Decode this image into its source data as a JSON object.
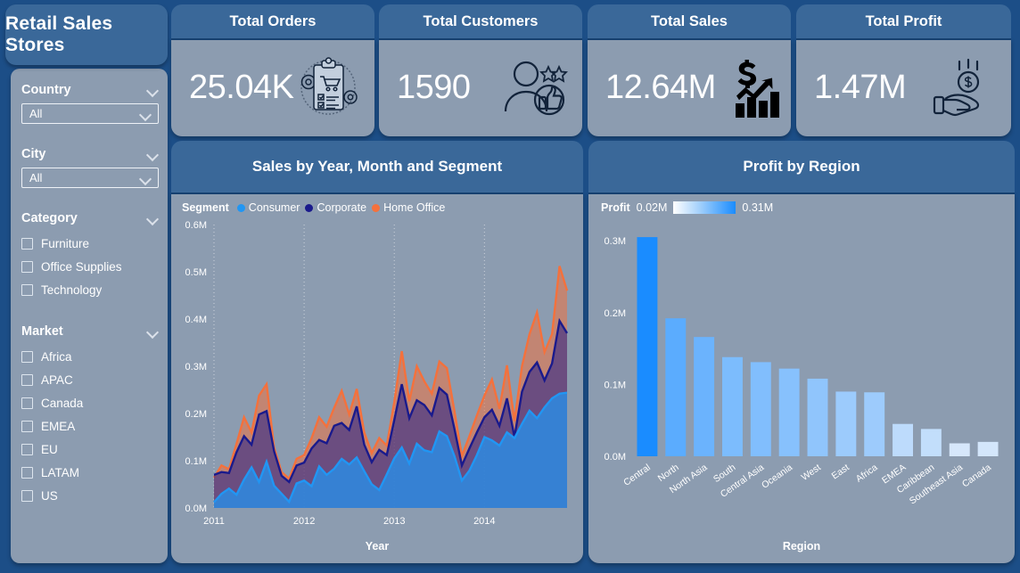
{
  "app": {
    "title": "Retail Sales Stores"
  },
  "sidebar": {
    "filters": [
      {
        "label": "Country",
        "type": "dropdown",
        "value": "All"
      },
      {
        "label": "City",
        "type": "dropdown",
        "value": "All"
      },
      {
        "label": "Category",
        "type": "checkbox",
        "options": [
          "Furniture",
          "Office Supplies",
          "Technology"
        ]
      },
      {
        "label": "Market",
        "type": "checkbox",
        "options": [
          "Africa",
          "APAC",
          "Canada",
          "EMEA",
          "EU",
          "LATAM",
          "US"
        ]
      }
    ]
  },
  "kpis": [
    {
      "title": "Total Orders",
      "value": "25.04K",
      "icon": "clipboard-cart-icon"
    },
    {
      "title": "Total Customers",
      "value": "1590",
      "icon": "customer-thumbsup-icon"
    },
    {
      "title": "Total Sales",
      "value": "12.64M",
      "icon": "dollar-bar-chart-icon"
    },
    {
      "title": "Total Profit",
      "value": "1.47M",
      "icon": "hand-coin-icon"
    }
  ],
  "colors": {
    "page_background": "#1c4e87",
    "panel_header": "#3a6899",
    "panel_body": "#8c9cb0",
    "consumer": "#2196f3",
    "corporate": "#1a1a8c",
    "home_office": "#f4713c",
    "bar_high": "#1a8cff",
    "bar_low": "#d6e7fb"
  },
  "chart_data": [
    {
      "type": "area",
      "title": "Sales by Year, Month and Segment",
      "legend_title": "Segment",
      "legend_position": "top-left",
      "xlabel": "Year",
      "ylabel": "",
      "ylim": [
        0,
        0.6
      ],
      "ytick_labels": [
        "0.0M",
        "0.1M",
        "0.2M",
        "0.3M",
        "0.4M",
        "0.5M",
        "0.6M"
      ],
      "xtick_labels": [
        "2011",
        "2012",
        "2013",
        "2014"
      ],
      "grid": true,
      "stacked": false,
      "series": [
        {
          "name": "Consumer",
          "color": "#2196f3",
          "values": [
            0.012,
            0.03,
            0.041,
            0.028,
            0.06,
            0.086,
            0.055,
            0.098,
            0.047,
            0.03,
            0.013,
            0.052,
            0.058,
            0.046,
            0.088,
            0.07,
            0.083,
            0.104,
            0.092,
            0.107,
            0.078,
            0.05,
            0.038,
            0.071,
            0.105,
            0.128,
            0.094,
            0.136,
            0.122,
            0.118,
            0.162,
            0.152,
            0.11,
            0.058,
            0.079,
            0.112,
            0.15,
            0.143,
            0.132,
            0.16,
            0.148,
            0.178,
            0.206,
            0.19,
            0.213,
            0.232,
            0.242,
            0.244
          ]
        },
        {
          "name": "Corporate",
          "color": "#1a1a8c",
          "values": [
            0.07,
            0.076,
            0.074,
            0.118,
            0.152,
            0.134,
            0.198,
            0.205,
            0.12,
            0.068,
            0.055,
            0.09,
            0.096,
            0.126,
            0.144,
            0.137,
            0.174,
            0.18,
            0.165,
            0.215,
            0.134,
            0.097,
            0.123,
            0.112,
            0.186,
            0.262,
            0.19,
            0.228,
            0.218,
            0.196,
            0.254,
            0.24,
            0.168,
            0.09,
            0.126,
            0.16,
            0.192,
            0.208,
            0.174,
            0.232,
            0.15,
            0.246,
            0.288,
            0.308,
            0.27,
            0.306,
            0.396,
            0.37
          ]
        },
        {
          "name": "Home Office",
          "color": "#f4713c",
          "values": [
            0.064,
            0.09,
            0.082,
            0.136,
            0.192,
            0.16,
            0.238,
            0.262,
            0.128,
            0.076,
            0.062,
            0.104,
            0.112,
            0.148,
            0.192,
            0.172,
            0.212,
            0.248,
            0.198,
            0.252,
            0.16,
            0.116,
            0.148,
            0.132,
            0.224,
            0.332,
            0.226,
            0.3,
            0.268,
            0.242,
            0.31,
            0.296,
            0.206,
            0.11,
            0.152,
            0.196,
            0.238,
            0.272,
            0.21,
            0.302,
            0.184,
            0.3,
            0.368,
            0.414,
            0.33,
            0.368,
            0.512,
            0.46
          ]
        }
      ]
    },
    {
      "type": "bar",
      "title": "Profit by Region",
      "legend_title": "Profit",
      "legend_min": "0.02M",
      "legend_max": "0.31M",
      "xlabel": "Region",
      "ylabel": "",
      "ylim": [
        0,
        0.31
      ],
      "ytick_labels": [
        "0.0M",
        "0.1M",
        "0.2M",
        "0.3M"
      ],
      "grid": false,
      "categories": [
        "Central",
        "North",
        "North Asia",
        "South",
        "Central Asia",
        "Oceania",
        "West",
        "East",
        "Africa",
        "EMEA",
        "Caribbean",
        "Southeast Asia",
        "Canada"
      ],
      "values": [
        0.305,
        0.192,
        0.166,
        0.138,
        0.131,
        0.122,
        0.108,
        0.09,
        0.089,
        0.045,
        0.038,
        0.018,
        0.02
      ]
    }
  ]
}
